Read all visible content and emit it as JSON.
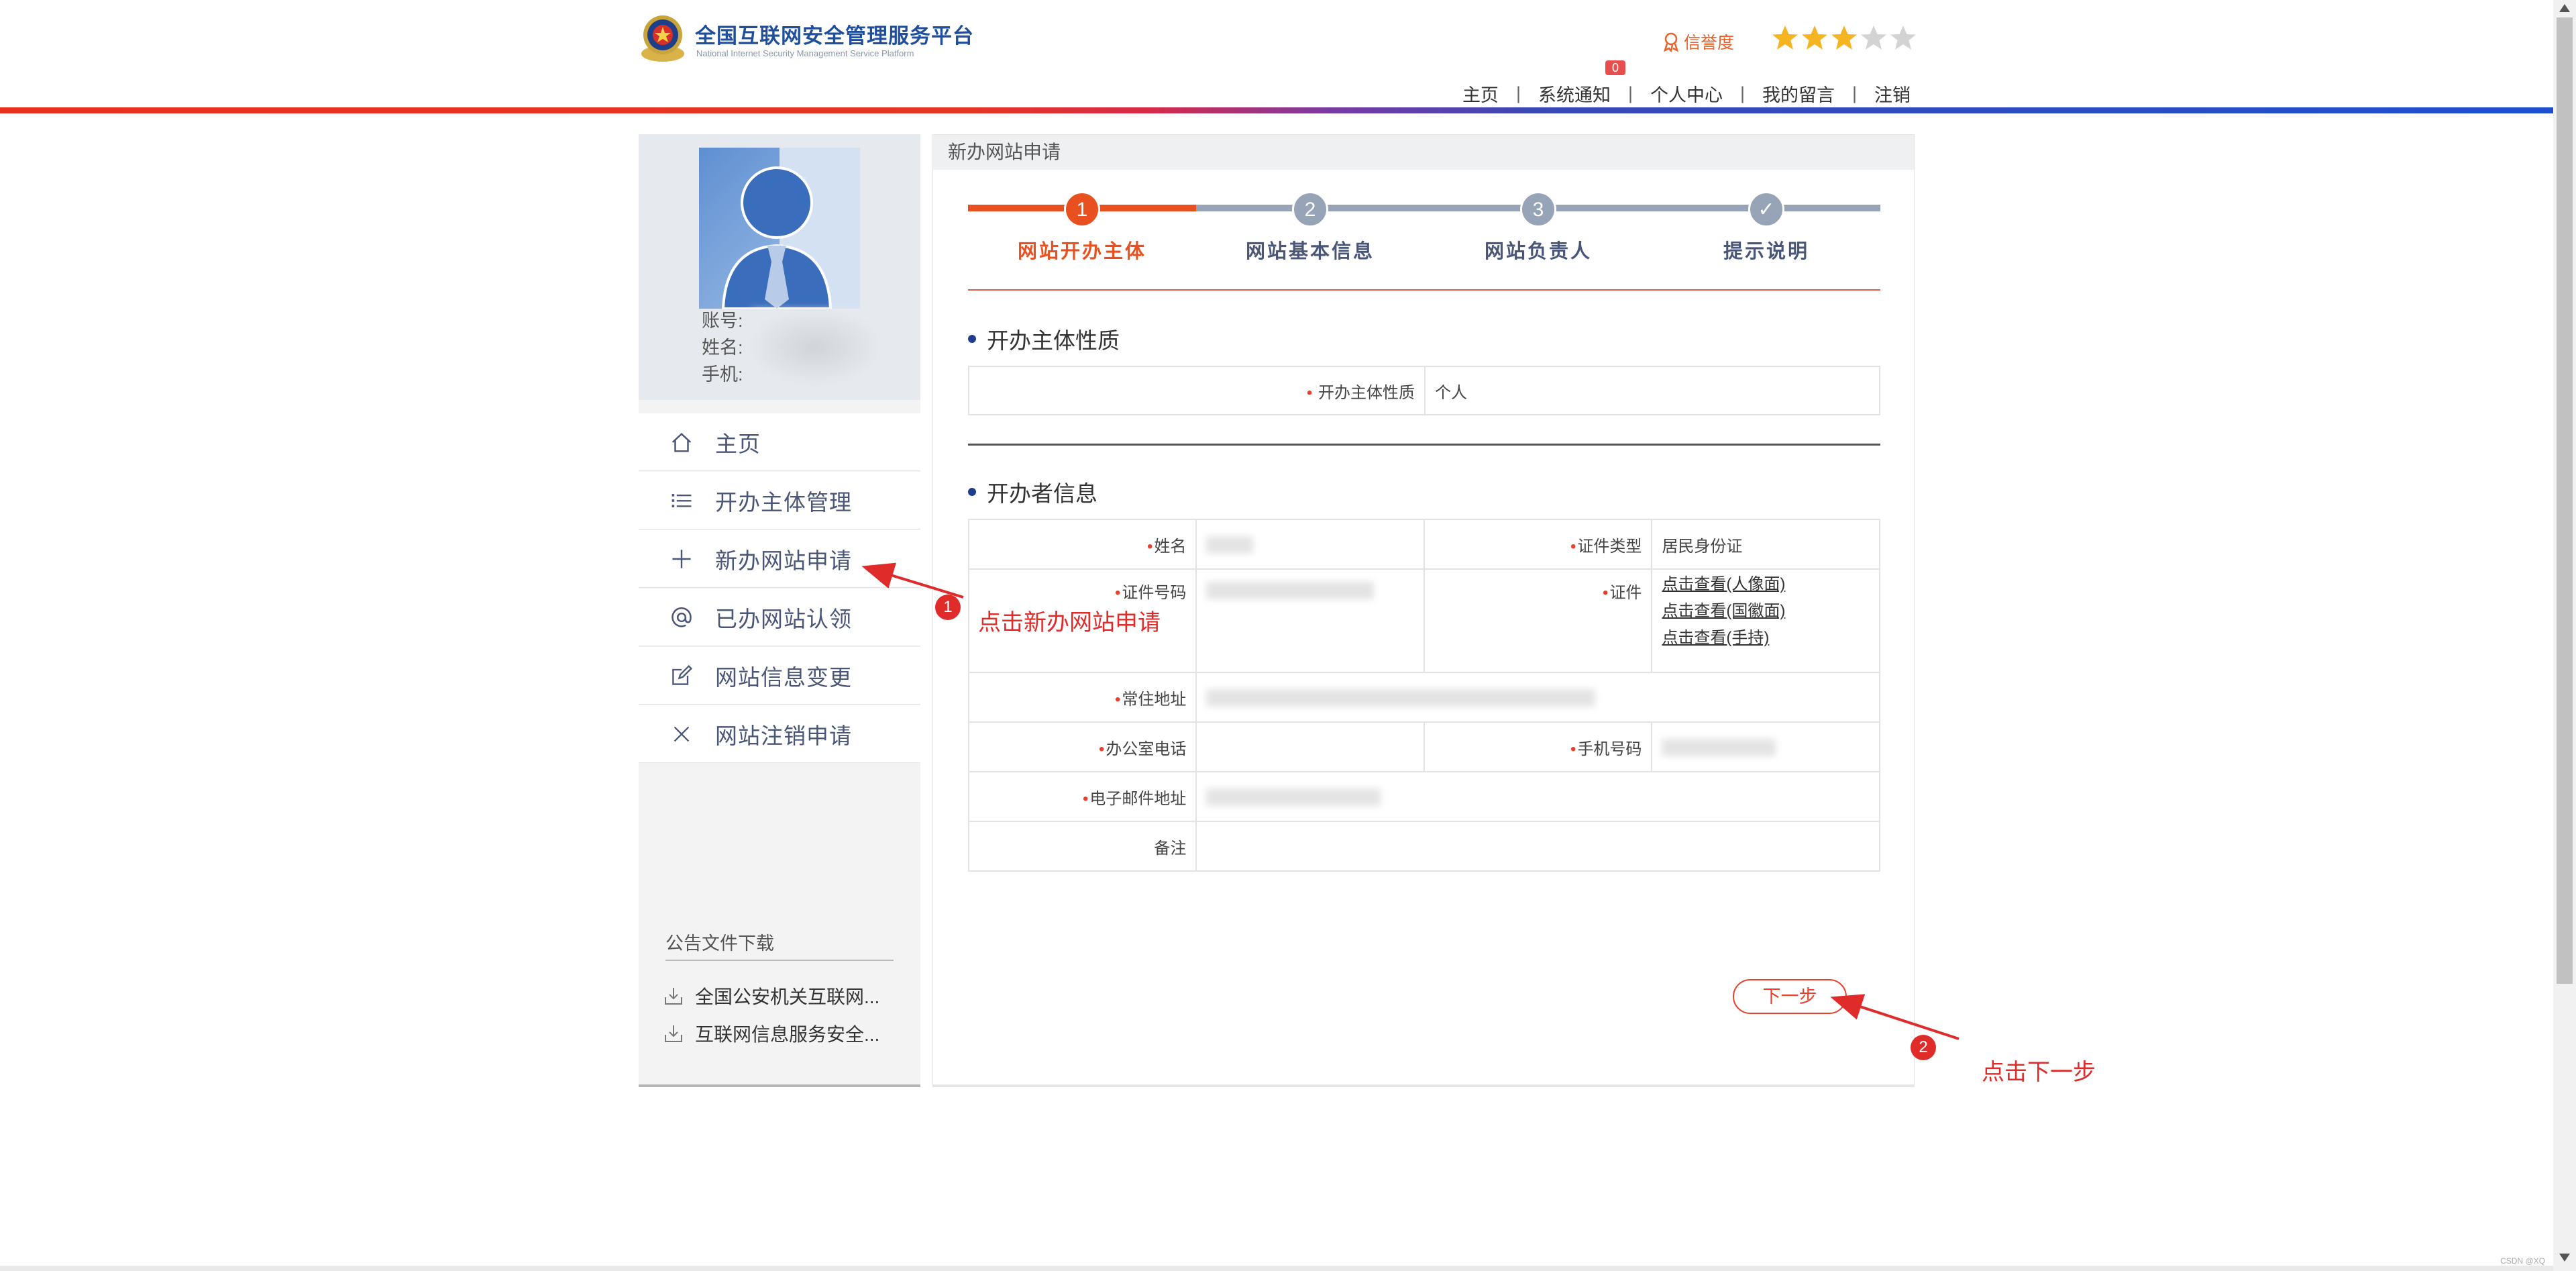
{
  "header": {
    "title": "全国互联网安全管理服务平台",
    "subtitle": "National Internet Security Management Service Platform",
    "credit_label": "信誉度",
    "stars_filled": 3,
    "stars_total": 5,
    "nav": [
      {
        "label": "主页"
      },
      {
        "label": "系统通知",
        "badge": "0"
      },
      {
        "label": "个人中心"
      },
      {
        "label": "我的留言"
      },
      {
        "label": "注销"
      }
    ]
  },
  "profile": {
    "account_label": "账号:",
    "name_label": "姓名:",
    "phone_label": "手机:"
  },
  "menu": [
    {
      "label": "主页",
      "icon": "home-icon"
    },
    {
      "label": "开办主体管理",
      "icon": "list-icon"
    },
    {
      "label": "新办网站申请",
      "icon": "plus-icon"
    },
    {
      "label": "已办网站认领",
      "icon": "at-icon"
    },
    {
      "label": "网站信息变更",
      "icon": "edit-icon"
    },
    {
      "label": "网站注销申请",
      "icon": "close-icon"
    }
  ],
  "downloads": {
    "title": "公告文件下载",
    "items": [
      "全国公安机关互联网...",
      "互联网信息服务安全..."
    ]
  },
  "main": {
    "header": "新办网站申请",
    "steps": [
      {
        "number": "1",
        "label": "网站开办主体",
        "active": true
      },
      {
        "number": "2",
        "label": "网站基本信息",
        "active": false
      },
      {
        "number": "3",
        "label": "网站负责人",
        "active": false
      },
      {
        "number": "✓",
        "label": "提示说明",
        "active": false
      }
    ],
    "section1_title": "开办主体性质",
    "entity_type_label": "开办主体性质",
    "entity_type_value": "个人",
    "section2_title": "开办者信息",
    "fields": {
      "name_label": "姓名",
      "id_type_label": "证件类型",
      "id_type_value": "居民身份证",
      "id_number_label": "证件号码",
      "cert_label": "证件",
      "cert_links": [
        "点击查看(人像面)",
        "点击查看(国徽面)",
        "点击查看(手持)"
      ],
      "address_label": "常住地址",
      "office_phone_label": "办公室电话",
      "mobile_label": "手机号码",
      "email_label": "电子邮件地址",
      "remark_label": "备注"
    },
    "next_button": "下一步"
  },
  "annotations": [
    {
      "number": "1",
      "text": "点击新办网站申请"
    },
    {
      "number": "2",
      "text": "点击下一步"
    }
  ],
  "colors": {
    "brand_blue": "#1f4e9c",
    "accent_red": "#e8402b",
    "active_step": "#e8511f",
    "inactive_step": "#97a3b6",
    "star_gold": "#f5b422",
    "annotation_red": "#e02b2b"
  },
  "watermark": "CSDN @XQ"
}
